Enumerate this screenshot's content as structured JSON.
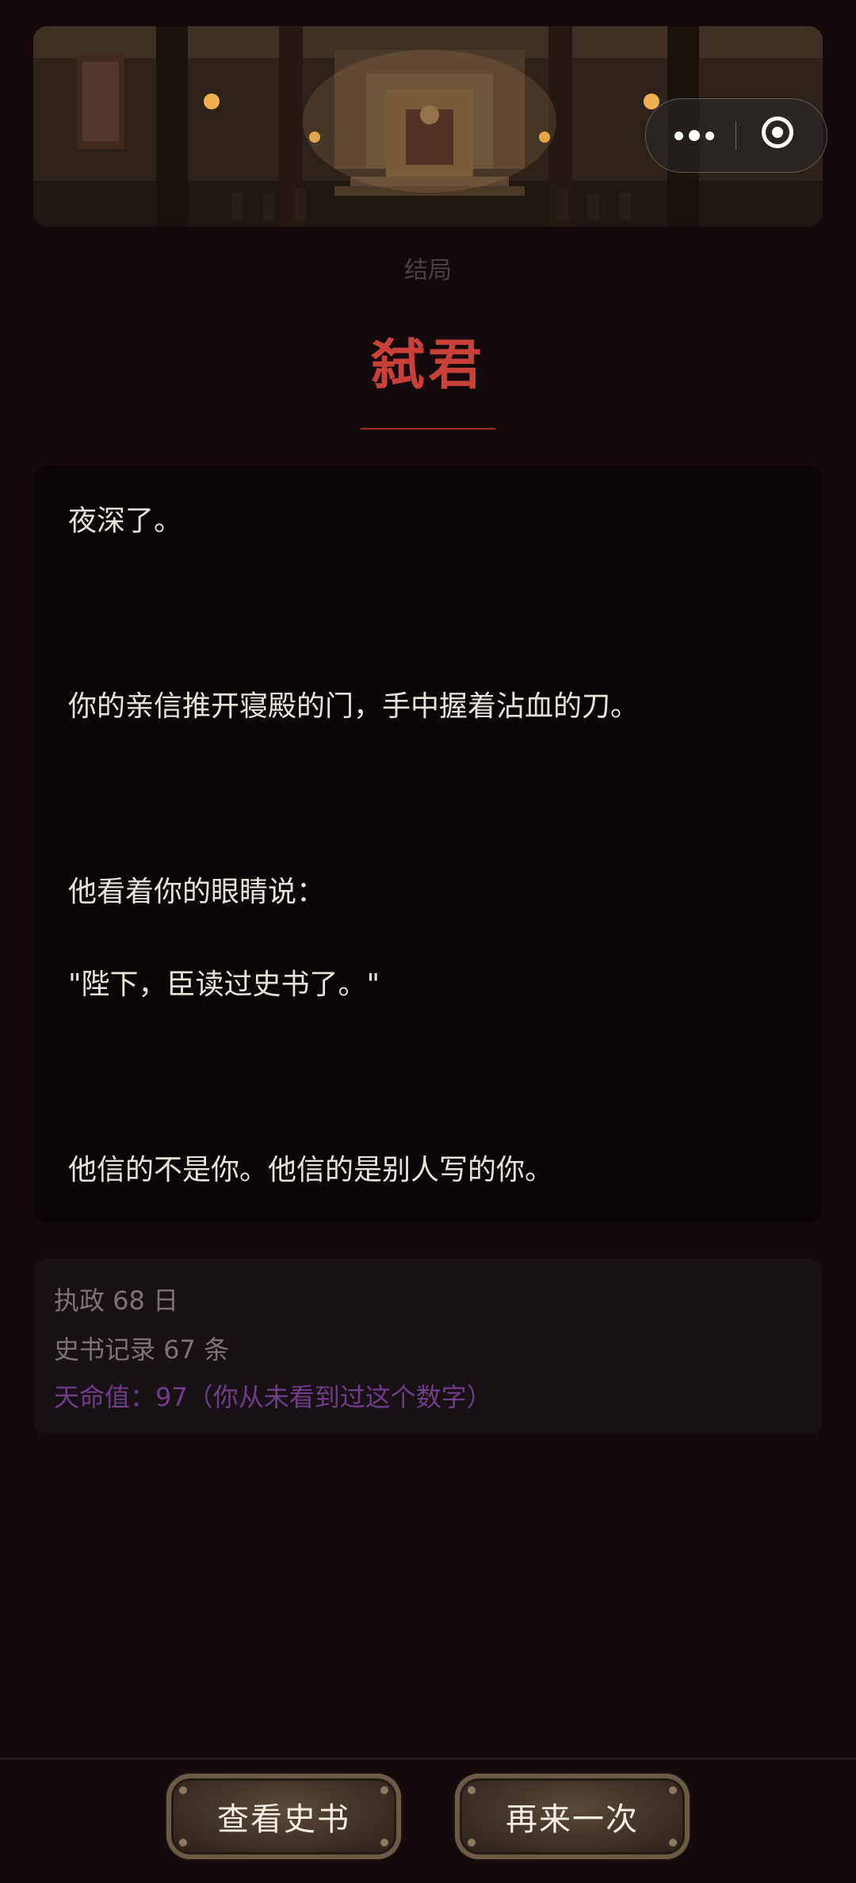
{
  "ending_label": "结局",
  "ending_title": "弑君",
  "story_lines": [
    "夜深了。",
    "你的亲信推开寝殿的门，手中握着沾血的刀。",
    "他看着你的眼睛说：",
    "\"陛下，臣读过史书了。\"",
    "他信的不是你。他信的是别人写的你。"
  ],
  "stats": {
    "reign_days": "执政 68 日",
    "history_records": "史书记录 67 条",
    "mandate_value": "天命值：97（你从未看到过这个数字）"
  },
  "buttons": {
    "view_history": "查看史书",
    "restart": "再来一次"
  },
  "colors": {
    "background": "#140a0b",
    "title_red": "#c8403a",
    "mandate_purple": "#6d3d86"
  },
  "capsule_icons": [
    "more-icon",
    "close-target-icon"
  ]
}
